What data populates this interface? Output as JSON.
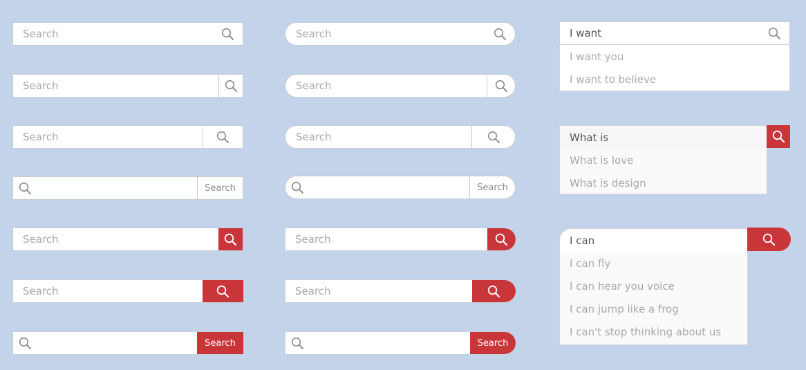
{
  "search": {
    "placeholder": "Search",
    "button_label": "Search"
  },
  "dropdown_1": {
    "query": "I want",
    "suggestions": [
      "I want you",
      "I want to believe"
    ]
  },
  "dropdown_2": {
    "query": "What is",
    "suggestions": [
      "What is love",
      "What is design"
    ]
  },
  "dropdown_3": {
    "query": "I can",
    "suggestions": [
      "I can fly",
      "I can hear you voice",
      "I can jump like a frog",
      "I can't stop thinking about us"
    ]
  },
  "colors": {
    "background": "#c3d3ea",
    "accent_red": "#c8363a",
    "border": "#c6cdd6",
    "placeholder_text": "#a9a9a9"
  },
  "icons": {
    "search": "magnifier-icon"
  }
}
